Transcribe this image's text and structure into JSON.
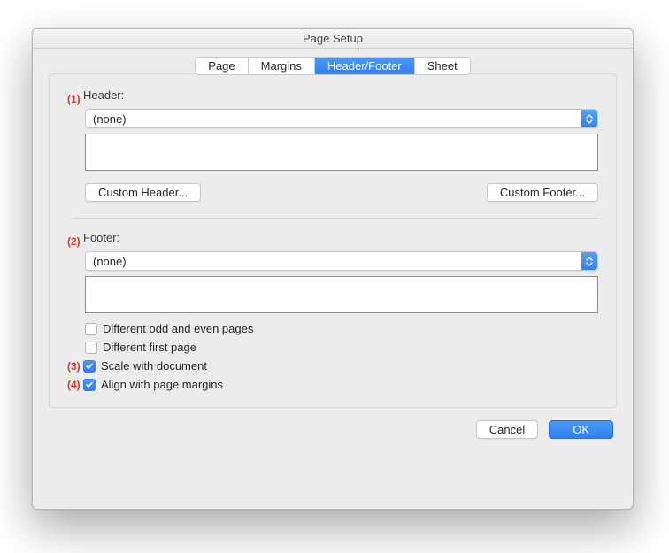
{
  "window": {
    "title": "Page Setup"
  },
  "tabs": {
    "page": "Page",
    "margins": "Margins",
    "headerfooter": "Header/Footer",
    "sheet": "Sheet"
  },
  "markers": {
    "m1": "(1)",
    "m2": "(2)",
    "m3": "(3)",
    "m4": "(4)"
  },
  "header": {
    "label": "Header:",
    "selected": "(none)",
    "custom_header_btn": "Custom Header...",
    "custom_footer_btn": "Custom Footer..."
  },
  "footer": {
    "label": "Footer:",
    "selected": "(none)"
  },
  "checks": {
    "diff_odd_even": "Different odd and even pages",
    "diff_first": "Different first page",
    "scale_doc": "Scale with document",
    "align_margins": "Align with page margins"
  },
  "buttons": {
    "cancel": "Cancel",
    "ok": "OK"
  }
}
